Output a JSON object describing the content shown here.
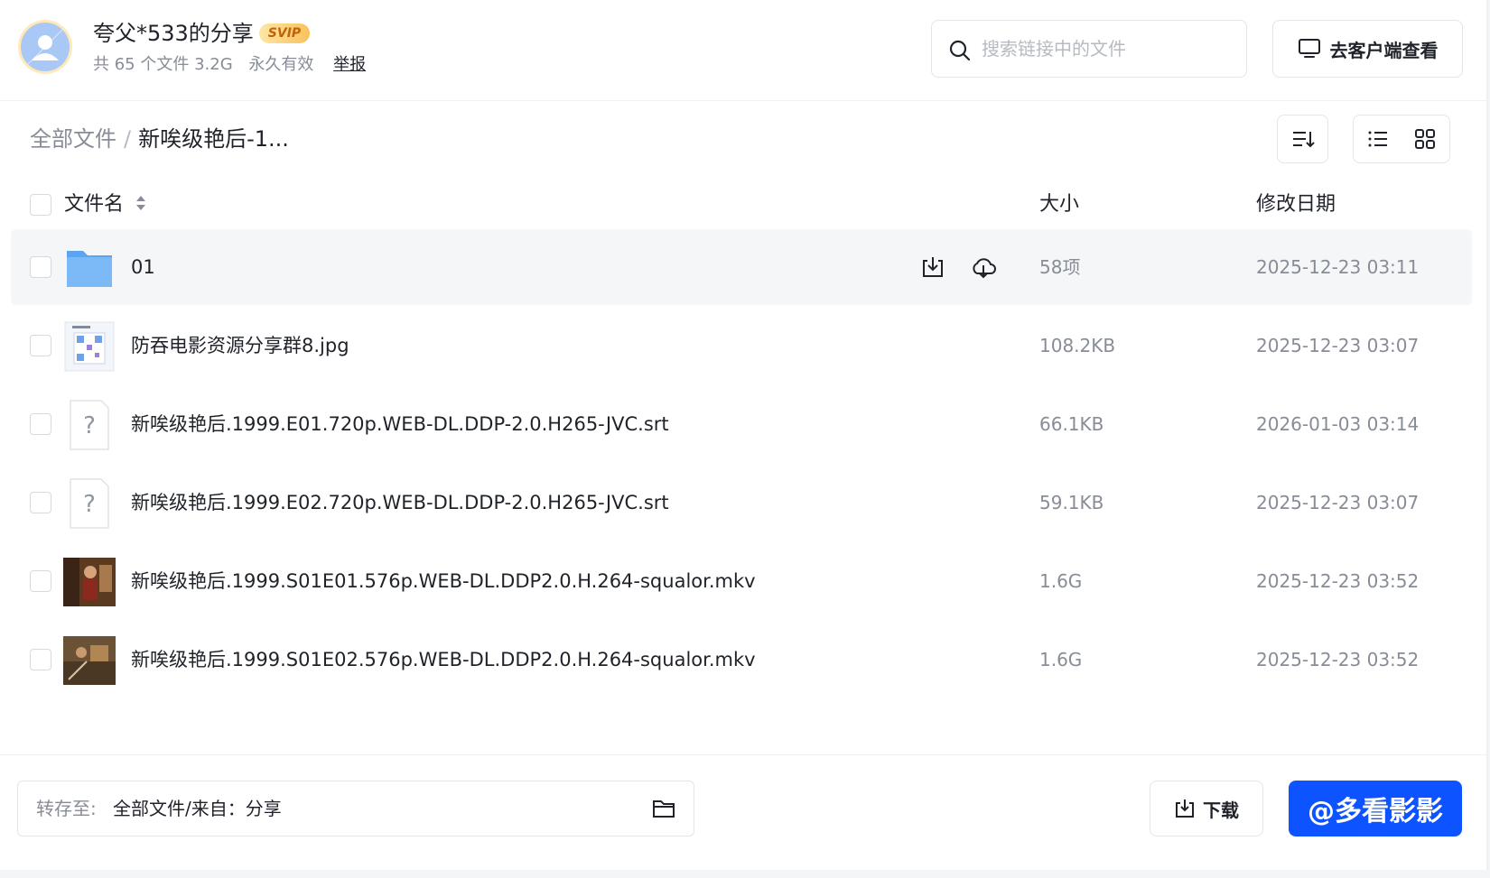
{
  "header": {
    "title": "夸父*533的分享",
    "badge": "SVIP",
    "meta_count": "共 65 个文件 3.2G",
    "meta_validity": "永久有效",
    "report_label": "举报",
    "search_placeholder": "搜索链接中的文件",
    "client_button_label": "去客户端查看"
  },
  "breadcrumb": {
    "root": "全部文件",
    "separator": "/",
    "current": "新唉级艳后-1..."
  },
  "table": {
    "col_name": "文件名",
    "col_size": "大小",
    "col_date": "修改日期",
    "rows": [
      {
        "name": "01",
        "size": "58项",
        "date": "2025-12-23 03:11",
        "icon": "folder-icon"
      },
      {
        "name": "防吞电影资源分享群8.jpg",
        "size": "108.2KB",
        "date": "2025-12-23 03:07",
        "icon": "image-thumbnail"
      },
      {
        "name": "新唉级艳后.1999.E01.720p.WEB-DL.DDP-2.0.H265-JVC.srt",
        "size": "66.1KB",
        "date": "2026-01-03 03:14",
        "icon": "unknown-file-icon"
      },
      {
        "name": "新唉级艳后.1999.E02.720p.WEB-DL.DDP-2.0.H265-JVC.srt",
        "size": "59.1KB",
        "date": "2025-12-23 03:07",
        "icon": "unknown-file-icon"
      },
      {
        "name": "新唉级艳后.1999.S01E01.576p.WEB-DL.DDP2.0.H.264-squalor.mkv",
        "size": "1.6G",
        "date": "2025-12-23 03:52",
        "icon": "video-thumbnail"
      },
      {
        "name": "新唉级艳后.1999.S01E02.576p.WEB-DL.DDP2.0.H.264-squalor.mkv",
        "size": "1.6G",
        "date": "2025-12-23 03:52",
        "icon": "video-thumbnail"
      }
    ]
  },
  "footer": {
    "dest_label": "转存至:",
    "dest_path": "全部文件/来自：分享",
    "download_label": "下载",
    "save_label": "@多看影影"
  },
  "colors": {
    "primary": "#0d53ff",
    "folder": "#6aaef5",
    "svip_gold": "#f7c25c"
  }
}
